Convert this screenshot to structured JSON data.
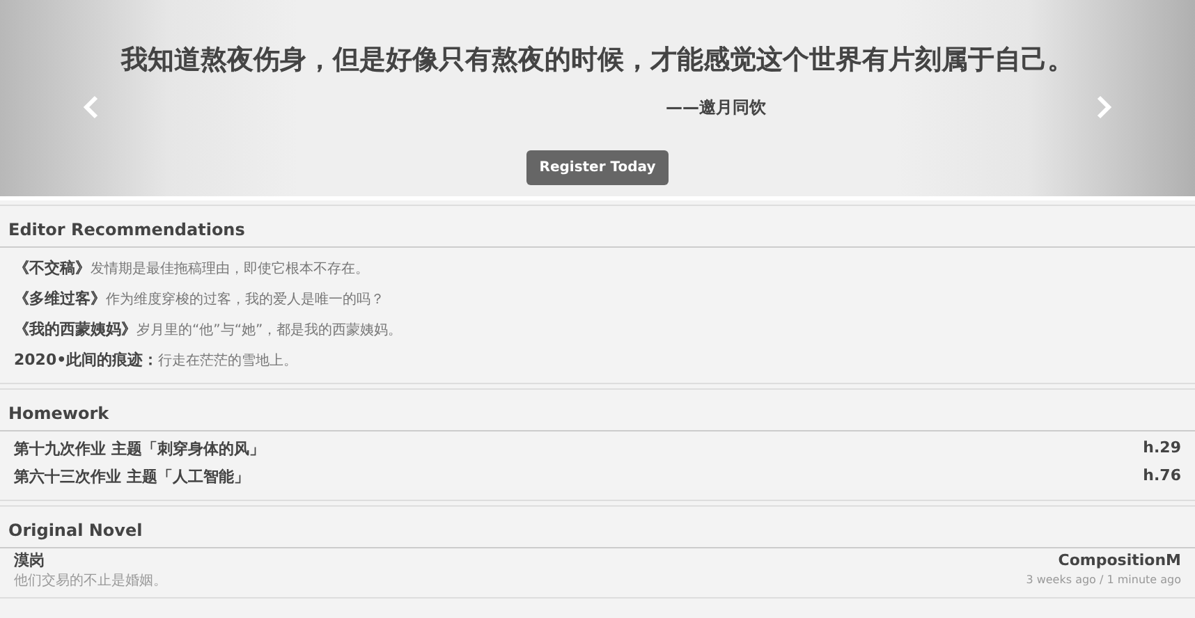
{
  "hero": {
    "quote": "我知道熬夜伤身，但是好像只有熬夜的时候，才能感觉这个世界有片刻属于自己。",
    "author": "——邀月同饮",
    "button": "Register Today"
  },
  "recommendations": {
    "title": "Editor Recommendations",
    "items": [
      "**《不交稿》**发情期是最佳拖稿理由，即使它根本不存在。",
      "**《多维过客》**作为维度穿梭的过客，我的爱人是唯一的吗？",
      "**《我的西蒙姨妈》**岁月里的“他”与“她”，都是我的西蒙姨妈。",
      "**2020•此间的痕迹：**行走在茫茫的雪地上。"
    ]
  },
  "homework": {
    "title": "Homework",
    "items": [
      {
        "title": "第十九次作业 主题「刺穿身体的风」",
        "count": "h.29"
      },
      {
        "title": "第六十三次作业 主题「人工智能」",
        "count": "h.76"
      }
    ]
  },
  "novels": {
    "title": "Original Novel",
    "items": [
      {
        "title": "漠岗",
        "summary": "他们交易的不止是婚姻。",
        "author": "CompositionM",
        "time": "3 weeks ago / 1 minute ago"
      }
    ]
  }
}
